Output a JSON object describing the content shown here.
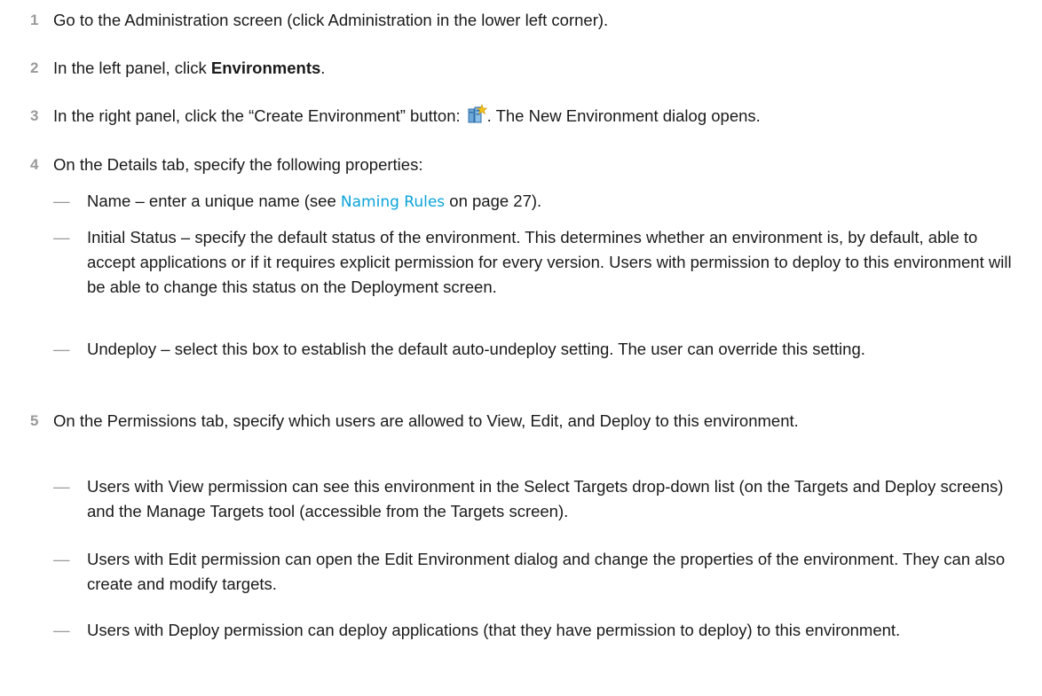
{
  "steps": [
    {
      "num": "1",
      "text": "Go to the Administration screen (click Administration in the lower left corner)."
    },
    {
      "num": "2",
      "pre": "In the left panel, click ",
      "bold": "Environments",
      "post": "."
    },
    {
      "num": "3",
      "pre": "In the right panel, click the “Create Environment” button:",
      "icon_name": "create-environment-icon",
      "post": ". The New Environment dialog opens."
    },
    {
      "num": "4",
      "text": "On the Details tab, specify the following properties:"
    },
    {
      "num": "5",
      "text": "On the Permissions tab, specify which users are allowed to View, Edit, and Deploy to this environment."
    }
  ],
  "details_bullets": [
    {
      "dash": "—",
      "pre": "Name – enter a unique name (see ",
      "link": "Naming Rules",
      "post": " on page 27)."
    },
    {
      "dash": "—",
      "text": "Initial Status – specify the default status of the environment. This determines whether an environment is, by default, able to accept applications or if it requires explicit permission for every version. Users with permission to deploy to this environment will be able to change this status on the Deployment screen."
    },
    {
      "dash": "—",
      "text": "Undeploy – select this box to establish the default auto-undeploy setting. The user can override this setting."
    }
  ],
  "permission_bullets": [
    {
      "dash": "—",
      "text": "Users with View permission can see this environment in the Select Targets drop-down list (on the Targets and Deploy screens) and the Manage Targets tool (accessible from the Targets screen)."
    },
    {
      "dash": "—",
      "text": "Users with Edit permission can open the Edit Environment dialog and change the properties of the environment. They can also create and modify targets."
    },
    {
      "dash": "—",
      "text": "Users with Deploy permission can deploy applications (that they have permission to deploy) to this environment."
    }
  ],
  "colors": {
    "step_number": "#9a9a9a",
    "link": "#0aa3d9",
    "text": "#1a1a1a"
  }
}
